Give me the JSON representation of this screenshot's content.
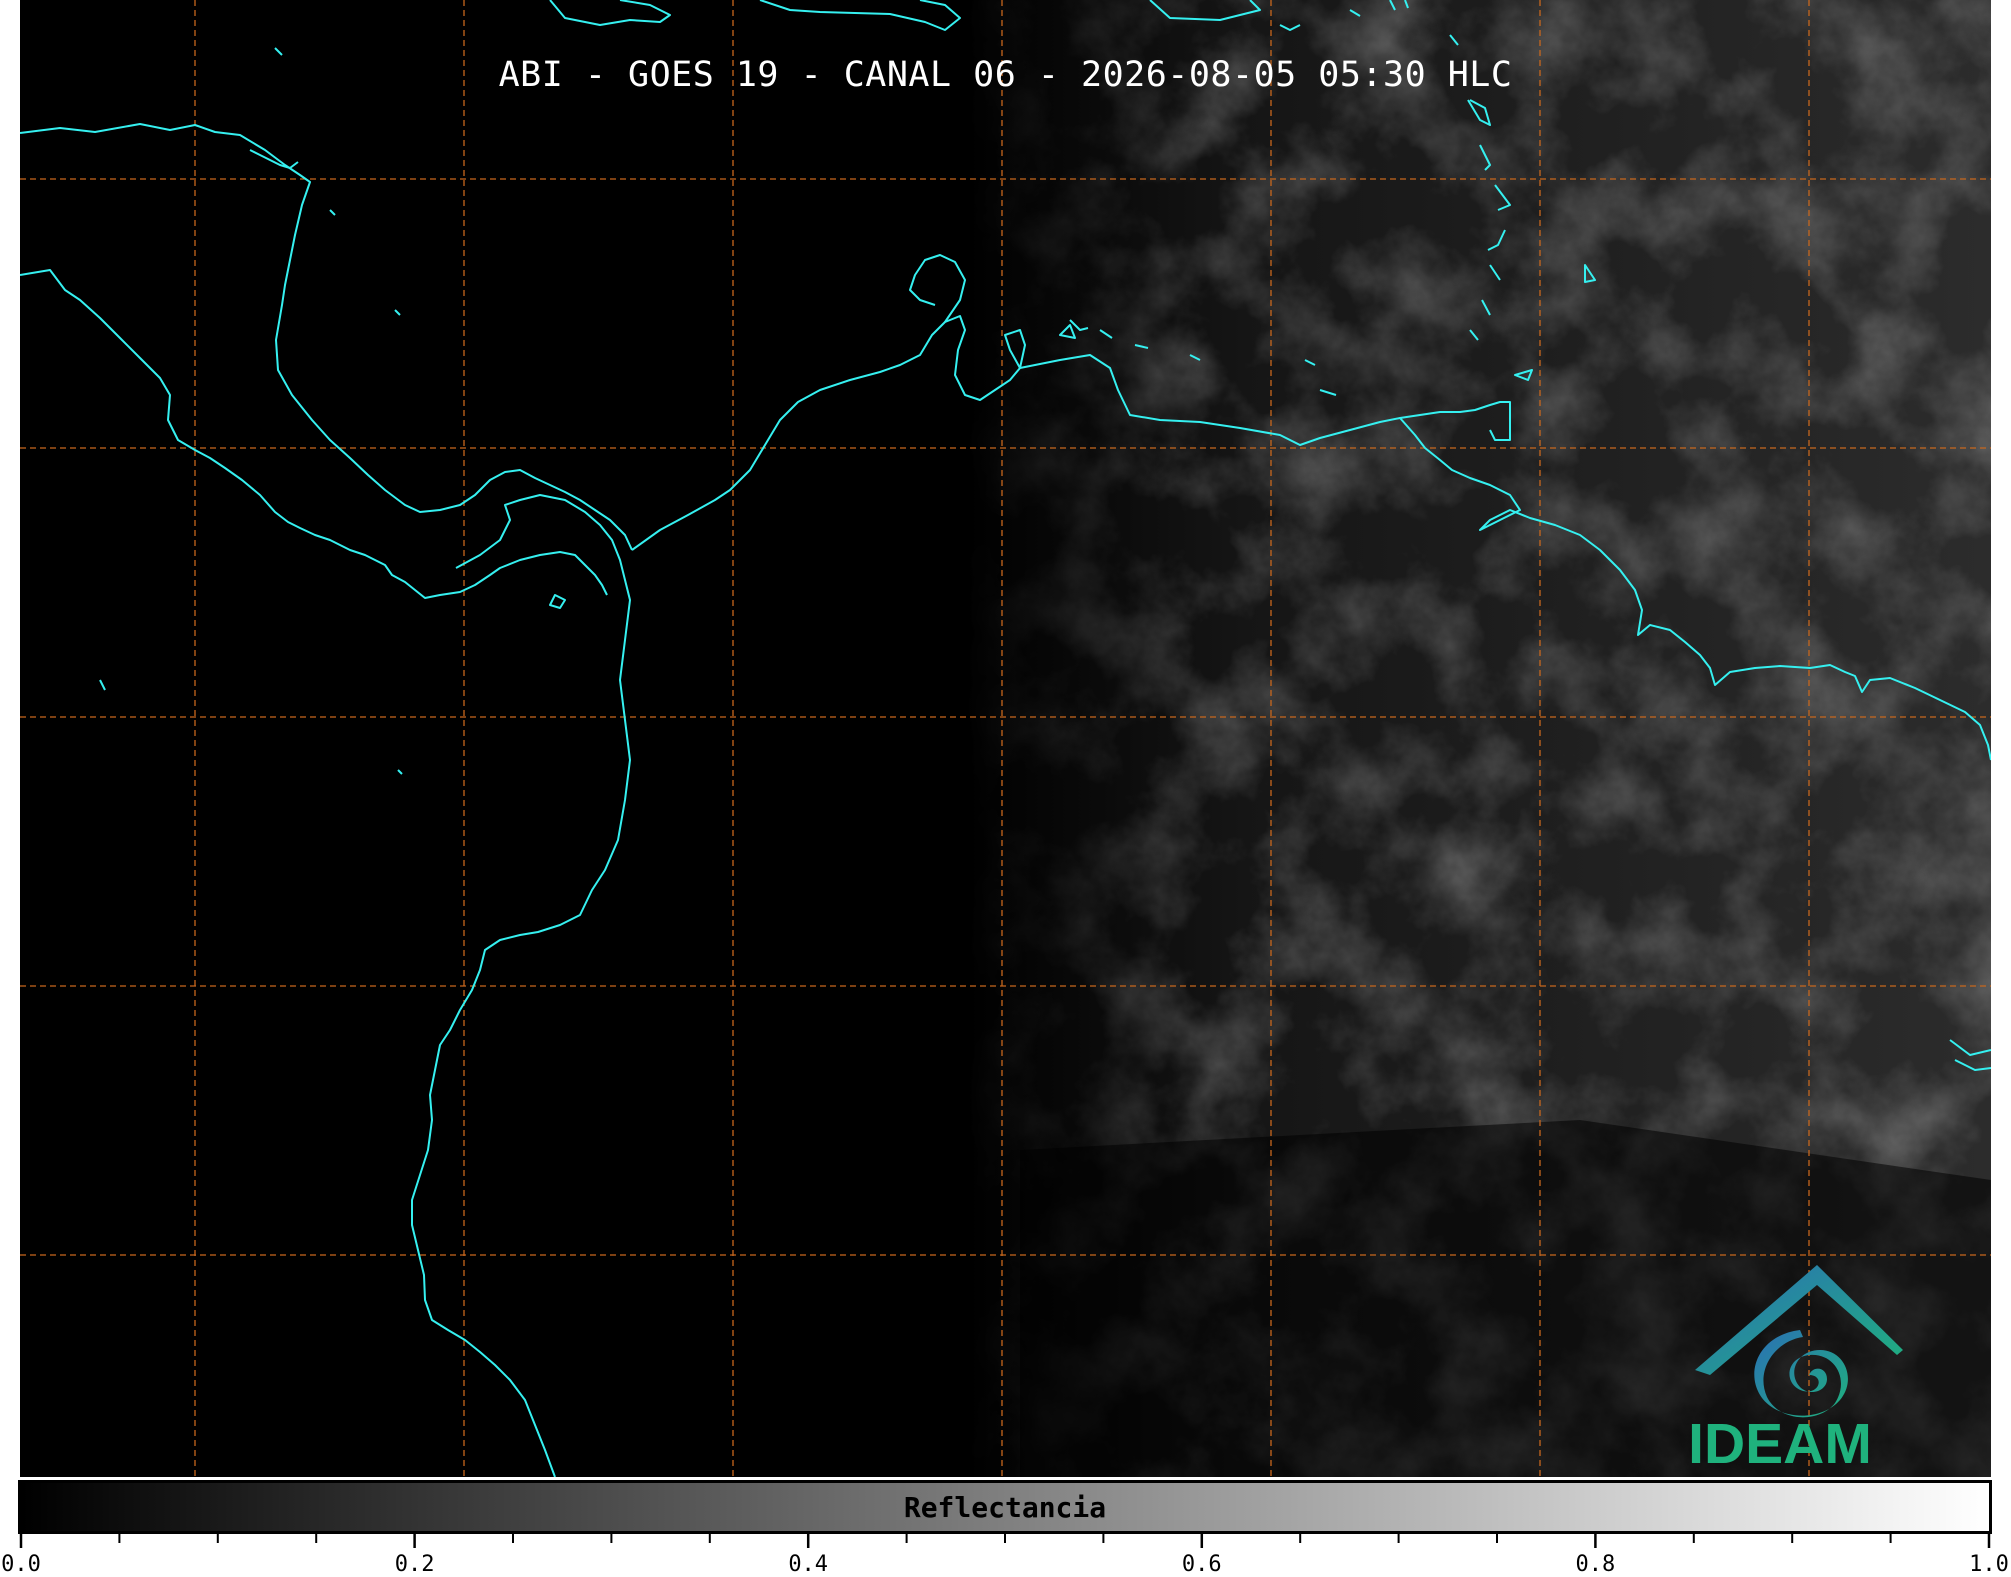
{
  "title": "ABI - GOES 19 - CANAL 06 - 2026-08-05 05:30 HLC",
  "logo": {
    "text": "IDEAM"
  },
  "colors": {
    "coastline": "#35f0f0",
    "graticule": "#c8671d",
    "logo_blue": "#2b6fb5",
    "logo_green": "#1fb27d"
  },
  "colorbar": {
    "label": "Reflectancia",
    "range": [
      0.0,
      1.0
    ],
    "colormap": "gray",
    "major_ticks": [
      "0.0",
      "0.2",
      "0.4",
      "0.6",
      "0.8",
      "1.0"
    ],
    "minor_tick_step": 0.05
  },
  "map": {
    "gridlines": "dashed",
    "icon": "satellite-image"
  }
}
